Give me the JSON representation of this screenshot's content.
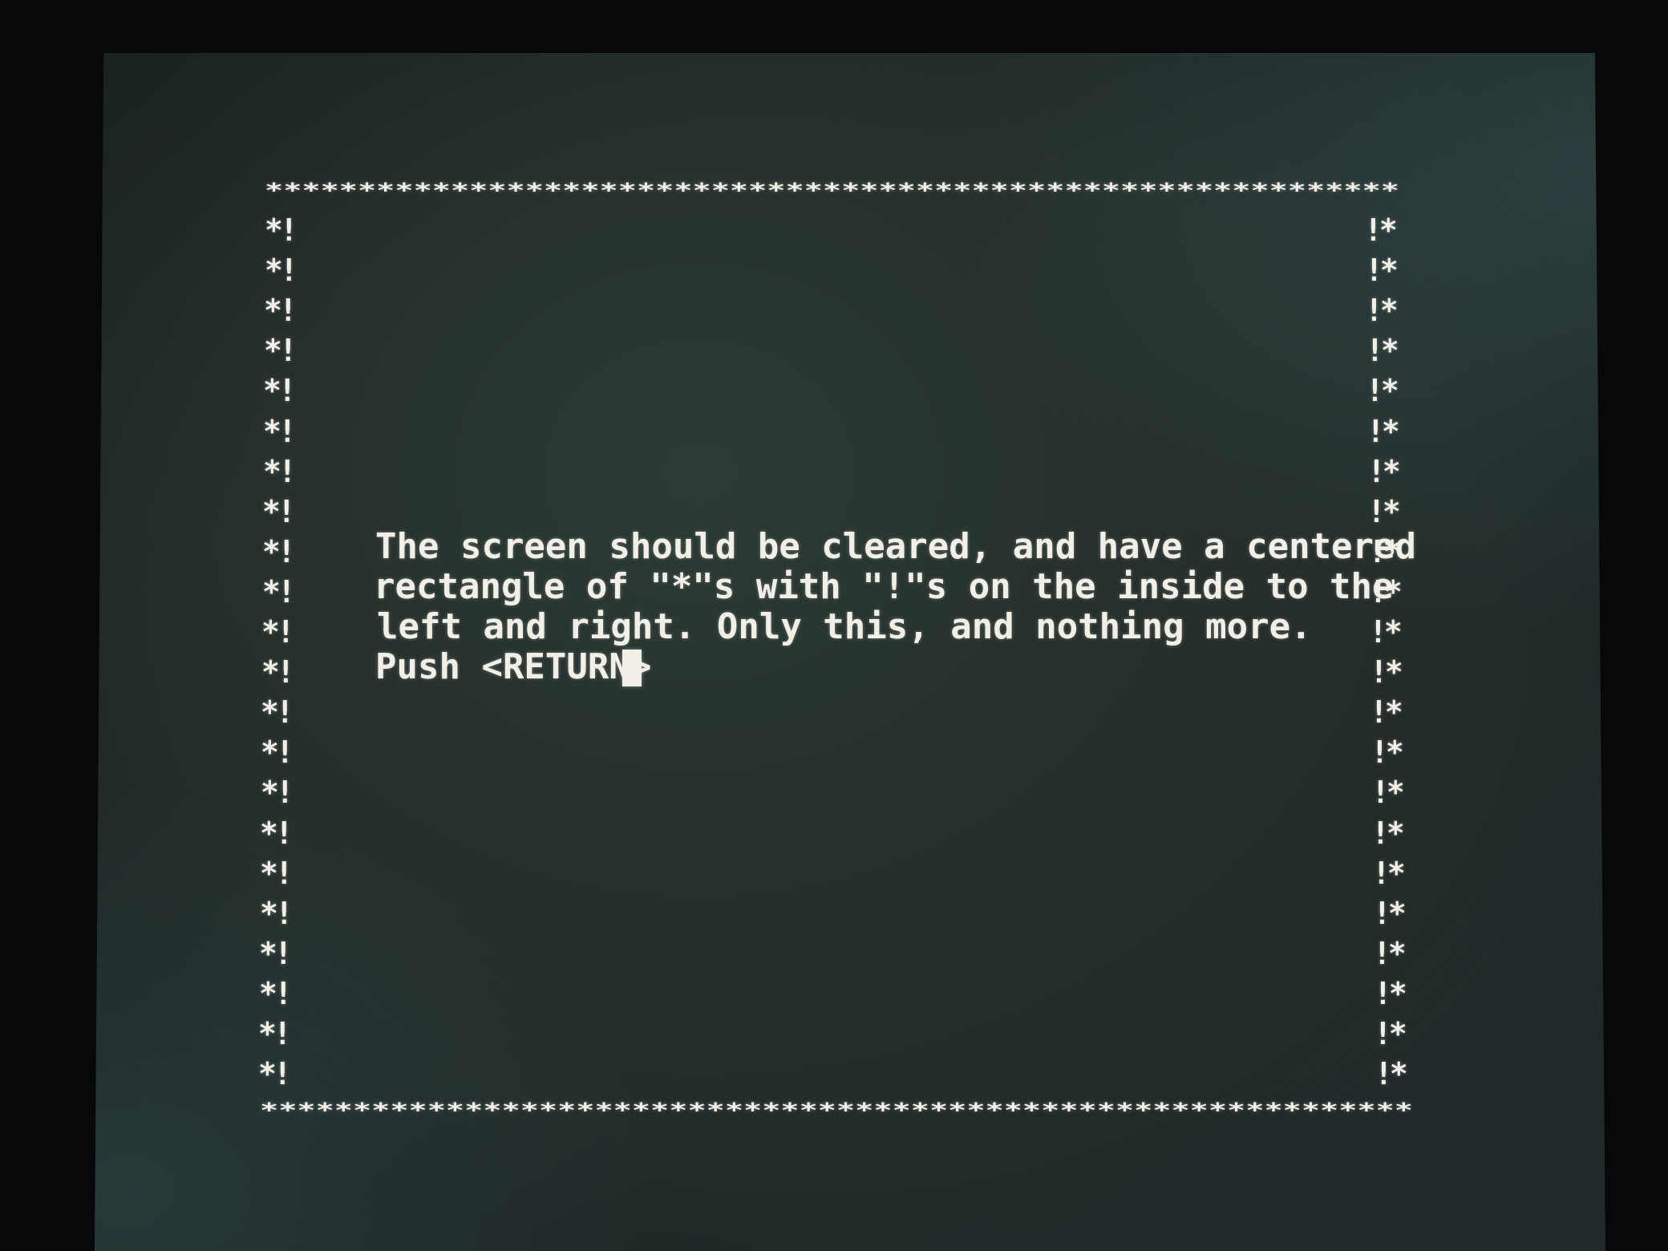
{
  "terminal": {
    "border_top": "*************************************************************",
    "border_bottom": "**************************************************************",
    "left_cell": "*!",
    "right_cell": "!*",
    "message_lines": [
      "The screen should be cleared, and have a centered",
      "rectangle of \"*\"s with \"!\"s on the inside to the",
      "left and right. Only this, and nothing more.",
      "Push <RETURN>"
    ]
  },
  "colors": {
    "screen_background": "#26302d",
    "text": "#f2efe6"
  }
}
